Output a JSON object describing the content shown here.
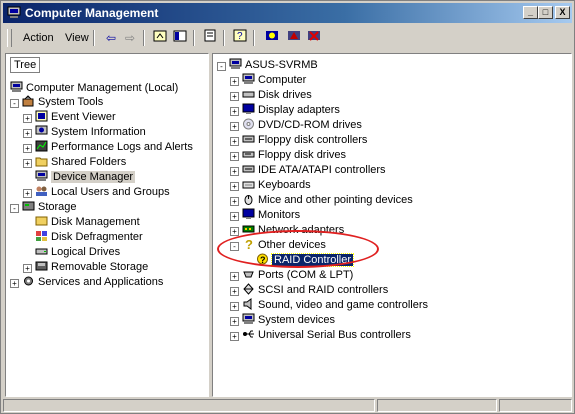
{
  "window": {
    "title": "Computer Management",
    "min": "_",
    "max": "□",
    "close": "X"
  },
  "menu": {
    "action": "Action",
    "view": "View"
  },
  "tree": {
    "tab": "Tree",
    "items": [
      {
        "label": "Computer Management (Local)",
        "icon": "computer-management-icon"
      },
      {
        "label": "System Tools",
        "icon": "tools-icon"
      },
      {
        "label": "Event Viewer",
        "icon": "event-viewer-icon"
      },
      {
        "label": "System Information",
        "icon": "system-info-icon"
      },
      {
        "label": "Performance Logs and Alerts",
        "icon": "perf-icon"
      },
      {
        "label": "Shared Folders",
        "icon": "folder-icon"
      },
      {
        "label": "Device Manager",
        "icon": "device-manager-icon"
      },
      {
        "label": "Local Users and Groups",
        "icon": "users-icon"
      },
      {
        "label": "Storage",
        "icon": "storage-icon"
      },
      {
        "label": "Disk Management",
        "icon": "disk-management-icon"
      },
      {
        "label": "Disk Defragmenter",
        "icon": "defrag-icon"
      },
      {
        "label": "Logical Drives",
        "icon": "drive-icon"
      },
      {
        "label": "Removable Storage",
        "icon": "removable-icon"
      },
      {
        "label": "Services and Applications",
        "icon": "services-icon"
      }
    ]
  },
  "devices": {
    "root": "ASUS-SVRMB",
    "items": [
      "Computer",
      "Disk drives",
      "Display adapters",
      "DVD/CD-ROM drives",
      "Floppy disk controllers",
      "Floppy disk drives",
      "IDE ATA/ATAPI controllers",
      "Keyboards",
      "Mice and other pointing devices",
      "Monitors",
      "Network adapters",
      "Other devices",
      "RAID Controller",
      "Ports (COM & LPT)",
      "SCSI and RAID controllers",
      "Sound, video and game controllers",
      "System devices",
      "Universal Serial Bus controllers"
    ]
  },
  "colors": {
    "highlight": "#0a246a",
    "annotation": "#e02020",
    "titlebar": "#0a246a"
  }
}
